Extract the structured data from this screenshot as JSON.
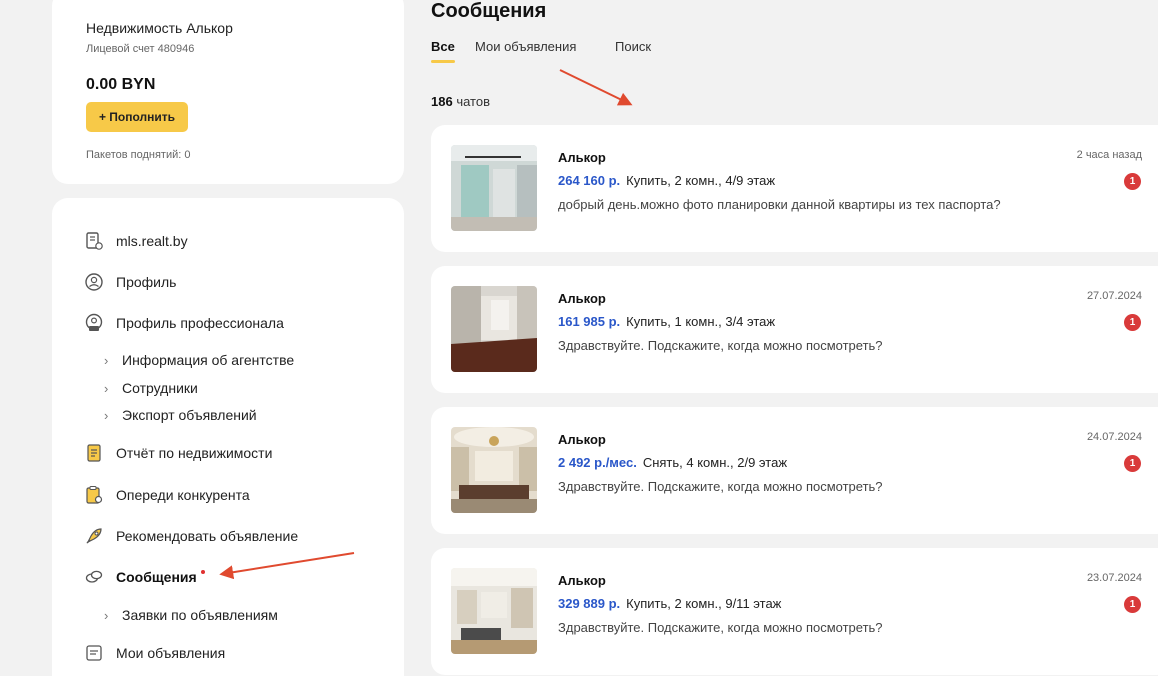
{
  "account": {
    "name": "Недвижимость Алькор",
    "account_number": "Лицевой счет 480946",
    "balance": "0.00 BYN",
    "topup_label": "+ Пополнить",
    "packets": "Пакетов поднятий: 0"
  },
  "menu": {
    "items": [
      {
        "label": "mls.realt.by",
        "icon": "mls-document-icon"
      },
      {
        "label": "Профиль",
        "icon": "user-circle-icon"
      },
      {
        "label": "Профиль профессионала",
        "icon": "pro-user-icon"
      },
      {
        "label": "Отчёт по недвижимости",
        "icon": "report-icon"
      },
      {
        "label": "Опереди конкурента",
        "icon": "clipboard-icon"
      },
      {
        "label": "Рекомендовать объявление",
        "icon": "rocket-icon"
      },
      {
        "label": "Сообщения",
        "icon": "chat-bubbles-icon"
      },
      {
        "label": "Мои объявления",
        "icon": "listing-icon"
      }
    ],
    "pro_subitems": [
      {
        "label": "Информация об агентстве"
      },
      {
        "label": "Сотрудники"
      },
      {
        "label": "Экспорт объявлений"
      }
    ],
    "messages_subitems": [
      {
        "label": "Заявки по объявлениям"
      }
    ]
  },
  "header": {
    "title": "Сообщения",
    "tabs": [
      {
        "label": "Все",
        "active": true
      },
      {
        "label": "Мои объявления",
        "active": false
      },
      {
        "label": "Поиск",
        "active": false
      }
    ],
    "count_number": "186",
    "count_suffix": " чатов"
  },
  "chats": [
    {
      "name": "Алькор",
      "price": "264 160 р.",
      "details": "Купить, 2 комн., 4/9 этаж",
      "message": "добрый день.можно фото планировки данной квартиры из тех паспорта?",
      "date": "2 часа назад",
      "unread": "1"
    },
    {
      "name": "Алькор",
      "price": "161 985 р.",
      "details": "Купить, 1 комн., 3/4 этаж",
      "message": "Здравствуйте. Подскажите, когда можно посмотреть?",
      "date": "27.07.2024",
      "unread": "1"
    },
    {
      "name": "Алькор",
      "price": "2 492 р./мес.",
      "details": "Снять, 4 комн., 2/9 этаж",
      "message": "Здравствуйте. Подскажите, когда можно посмотреть?",
      "date": "24.07.2024",
      "unread": "1"
    },
    {
      "name": "Алькор",
      "price": "329 889 р.",
      "details": "Купить, 2 комн., 9/11 этаж",
      "message": "Здравствуйте. Подскажите, когда можно посмотреть?",
      "date": "23.07.2024",
      "unread": "1"
    }
  ],
  "colors": {
    "accent_yellow": "#f7c948",
    "price_blue": "#2a57c9",
    "badge_red": "#d93a3a",
    "annotation_arrow": "#e04a2f"
  }
}
